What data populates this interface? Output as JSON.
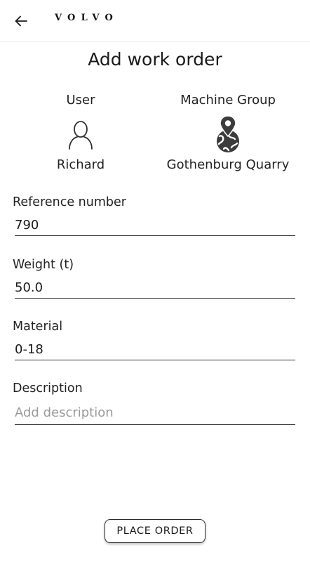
{
  "header": {
    "back_icon": "arrow-left-icon",
    "brand": "VOLVO"
  },
  "page": {
    "title": "Add work order"
  },
  "info": {
    "user": {
      "label": "User",
      "icon": "person-icon",
      "value": "Richard"
    },
    "machine_group": {
      "label": "Machine Group",
      "icon": "location-globe-icon",
      "value": "Gothenburg Quarry"
    }
  },
  "form": {
    "reference": {
      "label": "Reference number",
      "value": "790"
    },
    "weight": {
      "label": "Weight (t)",
      "value": "50.0"
    },
    "material": {
      "label": "Material",
      "value": "0-18"
    },
    "description": {
      "label": "Description",
      "value": "",
      "placeholder": "Add description"
    }
  },
  "actions": {
    "place_order": "PLACE ORDER"
  },
  "colors": {
    "text": "#1a1a1a",
    "placeholder": "#9a9a9a",
    "icon": "#3c3c3c"
  }
}
